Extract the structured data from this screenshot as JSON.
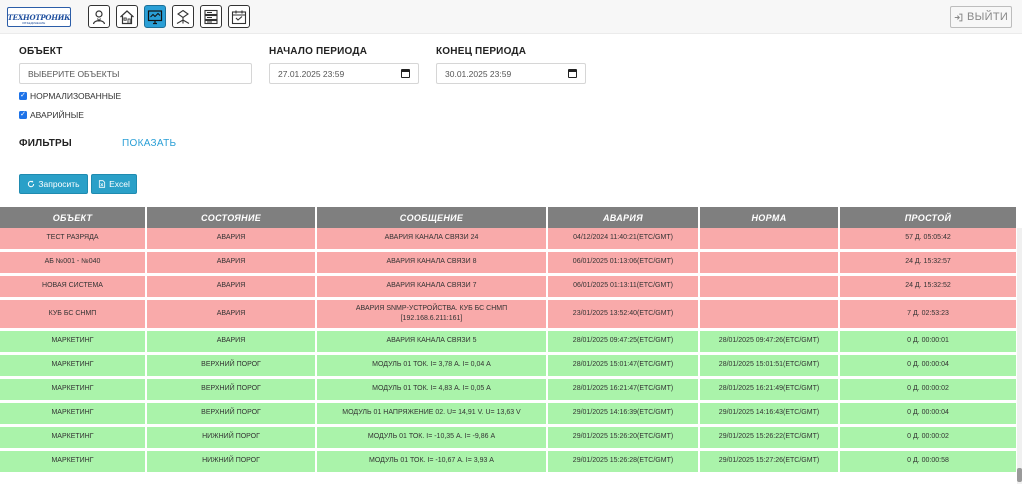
{
  "header": {
    "logo_text": "ТЕХНОТРОНИК",
    "logo_sub": "ОБЪЕДИНЕНИЕ",
    "nav_icons": [
      "user-icon",
      "home-icon",
      "monitor-icon",
      "network-icon",
      "server-icon",
      "calendar-icon"
    ],
    "active_nav_index": 2,
    "logout_label": "ВЫЙТИ"
  },
  "form": {
    "object_label": "ОБЪЕКТ",
    "object_value": "ВЫБЕРИТЕ ОБЪЕКТЫ",
    "start_label": "НАЧАЛО ПЕРИОДА",
    "start_value": "27.01.2025 23:59",
    "end_label": "КОНЕЦ ПЕРИОДА",
    "end_value": "30.01.2025 23:59",
    "normalized_label": "НОРМАЛИЗОВАННЫЕ",
    "normalized_checked": true,
    "alarm_label": "АВАРИЙНЫЕ",
    "alarm_checked": true,
    "filters_label": "ФИЛЬТРЫ",
    "show_label": "ПОКАЗАТЬ",
    "query_label": "Запросить",
    "excel_label": "Excel"
  },
  "table": {
    "columns": [
      "ОБЪЕКТ",
      "СОСТОЯНИЕ",
      "СООБЩЕНИЕ",
      "АВАРИЯ",
      "НОРМА",
      "ПРОСТОЙ"
    ],
    "rows": [
      {
        "status": "red",
        "object": "ТЕСТ РАЗРЯДА",
        "state": "АВАРИЯ",
        "message": [
          "АВАРИЯ КАНАЛА СВЯЗИ 24"
        ],
        "alarm": "04/12/2024 11:40:21(ETC/GMT)",
        "norm": "",
        "downtime": "57 Д. 05:05:42"
      },
      {
        "status": "red",
        "object": "АБ №001 - №040",
        "state": "АВАРИЯ",
        "message": [
          "АВАРИЯ КАНАЛА СВЯЗИ 8"
        ],
        "alarm": "06/01/2025 01:13:06(ETC/GMT)",
        "norm": "",
        "downtime": "24 Д. 15:32:57"
      },
      {
        "status": "red",
        "object": "НОВАЯ СИСТЕМА",
        "state": "АВАРИЯ",
        "message": [
          "АВАРИЯ КАНАЛА СВЯЗИ 7"
        ],
        "alarm": "06/01/2025 01:13:11(ETC/GMT)",
        "norm": "",
        "downtime": "24 Д. 15:32:52"
      },
      {
        "status": "red",
        "object": "КУБ БС СНМП",
        "state": "АВАРИЯ",
        "message": [
          "АВАРИЯ SNMP-УСТРОЙСТВА. КУБ БС СНМП",
          "[192.168.6.211:161]"
        ],
        "alarm": "23/01/2025 13:52:40(ETC/GMT)",
        "norm": "",
        "downtime": "7 Д. 02:53:23"
      },
      {
        "status": "green",
        "object": "МАРКЕТИНГ",
        "state": "АВАРИЯ",
        "message": [
          "АВАРИЯ КАНАЛА СВЯЗИ 5"
        ],
        "alarm": "28/01/2025 09:47:25(ETC/GMT)",
        "norm": "28/01/2025 09:47:26(ETC/GMT)",
        "downtime": "0 Д. 00:00:01"
      },
      {
        "status": "green",
        "object": "МАРКЕТИНГ",
        "state": "ВЕРХНИЙ ПОРОГ",
        "message": [
          "МОДУЛЬ 01 ТОК. I= 3,78 А. I= 0,04 А"
        ],
        "alarm": "28/01/2025 15:01:47(ETC/GMT)",
        "norm": "28/01/2025 15:01:51(ETC/GMT)",
        "downtime": "0 Д. 00:00:04"
      },
      {
        "status": "green",
        "object": "МАРКЕТИНГ",
        "state": "ВЕРХНИЙ ПОРОГ",
        "message": [
          "МОДУЛЬ 01 ТОК. I= 4,83 А. I= 0,05 А"
        ],
        "alarm": "28/01/2025 16:21:47(ETC/GMT)",
        "norm": "28/01/2025 16:21:49(ETC/GMT)",
        "downtime": "0 Д. 00:00:02"
      },
      {
        "status": "green",
        "object": "МАРКЕТИНГ",
        "state": "ВЕРХНИЙ ПОРОГ",
        "message": [
          "МОДУЛЬ 01 НАПРЯЖЕНИЕ 02. U= 14,91 V. U= 13,63 V"
        ],
        "alarm": "29/01/2025 14:16:39(ETC/GMT)",
        "norm": "29/01/2025 14:16:43(ETC/GMT)",
        "downtime": "0 Д. 00:00:04"
      },
      {
        "status": "green",
        "object": "МАРКЕТИНГ",
        "state": "НИЖНИЙ ПОРОГ",
        "message": [
          "МОДУЛЬ 01 ТОК. I= -10,35 А. I= -9,86 А"
        ],
        "alarm": "29/01/2025 15:26:20(ETC/GMT)",
        "norm": "29/01/2025 15:26:22(ETC/GMT)",
        "downtime": "0 Д. 00:00:02"
      },
      {
        "status": "green",
        "object": "МАРКЕТИНГ",
        "state": "НИЖНИЙ ПОРОГ",
        "message": [
          "МОДУЛЬ 01 ТОК. I= -10,67 А. I= 3,93 А"
        ],
        "alarm": "29/01/2025 15:26:28(ETC/GMT)",
        "norm": "29/01/2025 15:27:26(ETC/GMT)",
        "downtime": "0 Д. 00:00:58"
      }
    ]
  },
  "colors": {
    "alarm_row": "#f9aaaa",
    "normal_row": "#aaf3aa",
    "header_bg": "#7f7f7f",
    "accent": "#2aa0c8"
  }
}
